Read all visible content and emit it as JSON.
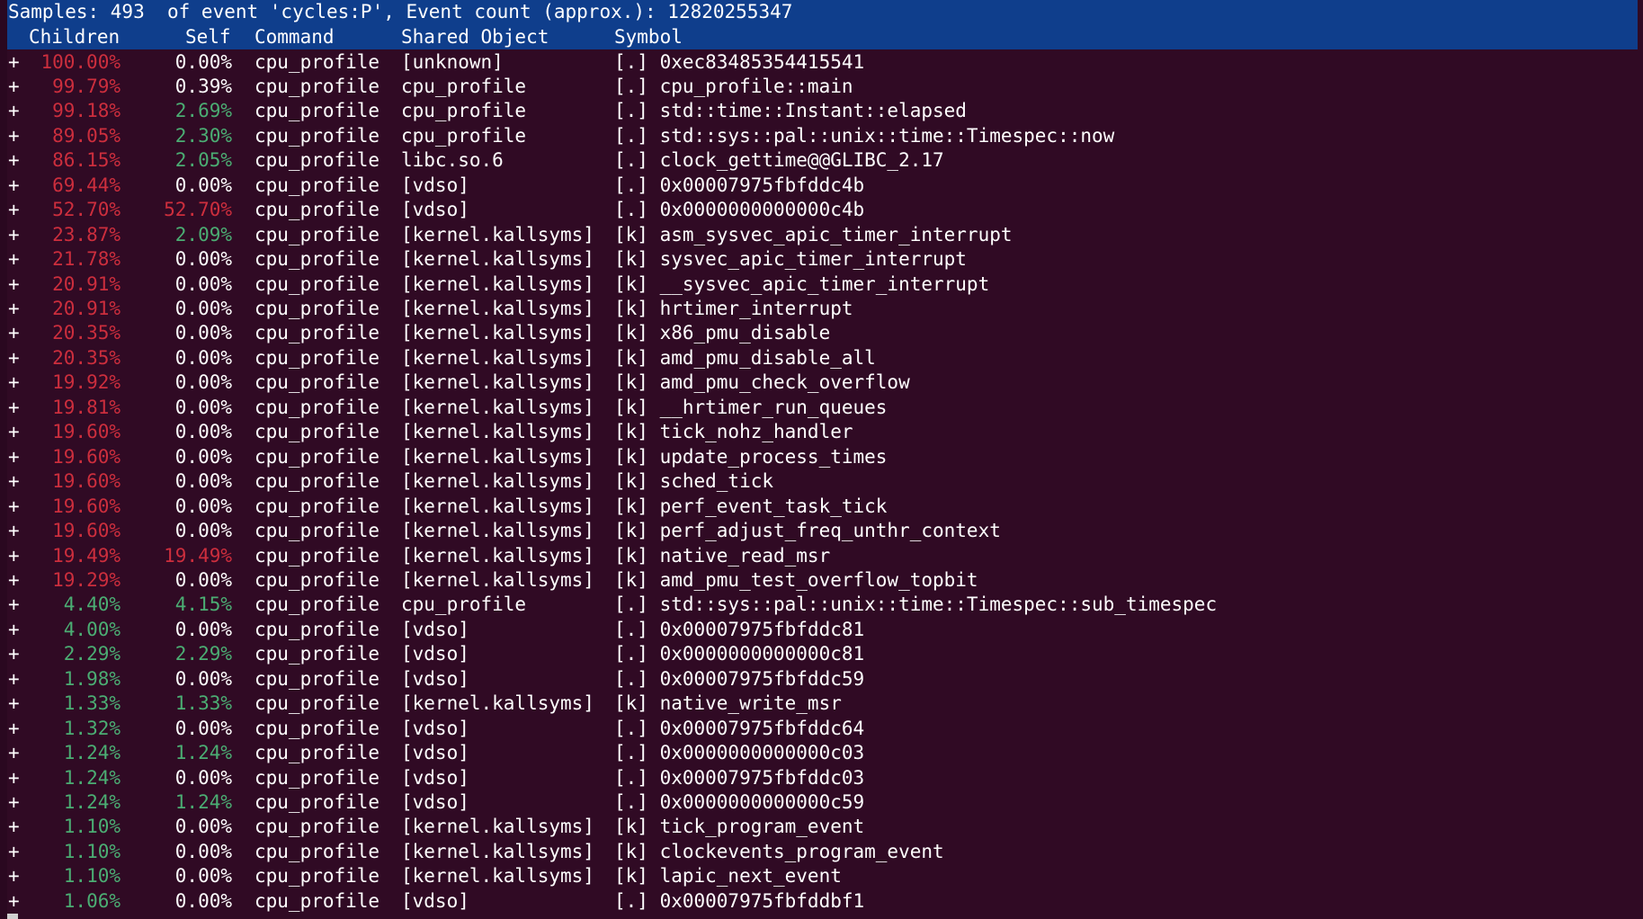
{
  "header": {
    "title": "Samples: 493  of event 'cycles:P', Event count (approx.): 12820255347",
    "columns": {
      "children": "Children",
      "self": "Self",
      "command": "Command",
      "shared_object": "Shared Object",
      "symbol": "Symbol"
    }
  },
  "colors": {
    "background": "#300a24",
    "header_bg": "#0f3e8c",
    "high_percent": "#cc2e3d",
    "low_percent": "#4bad73",
    "text": "#ffffff"
  },
  "rows": [
    {
      "expand": "+",
      "children": "100.00%",
      "children_color": "red",
      "self": "0.00%",
      "self_color": "white",
      "command": "cpu_profile",
      "object": "[unknown]",
      "symbol": "[.] 0xec83485354415541"
    },
    {
      "expand": "+",
      "children": "99.79%",
      "children_color": "red",
      "self": "0.39%",
      "self_color": "white",
      "command": "cpu_profile",
      "object": "cpu_profile",
      "symbol": "[.] cpu_profile::main"
    },
    {
      "expand": "+",
      "children": "99.18%",
      "children_color": "red",
      "self": "2.69%",
      "self_color": "green",
      "command": "cpu_profile",
      "object": "cpu_profile",
      "symbol": "[.] std::time::Instant::elapsed"
    },
    {
      "expand": "+",
      "children": "89.05%",
      "children_color": "red",
      "self": "2.30%",
      "self_color": "green",
      "command": "cpu_profile",
      "object": "cpu_profile",
      "symbol": "[.] std::sys::pal::unix::time::Timespec::now"
    },
    {
      "expand": "+",
      "children": "86.15%",
      "children_color": "red",
      "self": "2.05%",
      "self_color": "green",
      "command": "cpu_profile",
      "object": "libc.so.6",
      "symbol": "[.] clock_gettime@@GLIBC_2.17"
    },
    {
      "expand": "+",
      "children": "69.44%",
      "children_color": "red",
      "self": "0.00%",
      "self_color": "white",
      "command": "cpu_profile",
      "object": "[vdso]",
      "symbol": "[.] 0x00007975fbfddc4b"
    },
    {
      "expand": "+",
      "children": "52.70%",
      "children_color": "red",
      "self": "52.70%",
      "self_color": "red",
      "command": "cpu_profile",
      "object": "[vdso]",
      "symbol": "[.] 0x0000000000000c4b"
    },
    {
      "expand": "+",
      "children": "23.87%",
      "children_color": "red",
      "self": "2.09%",
      "self_color": "green",
      "command": "cpu_profile",
      "object": "[kernel.kallsyms]",
      "symbol": "[k] asm_sysvec_apic_timer_interrupt"
    },
    {
      "expand": "+",
      "children": "21.78%",
      "children_color": "red",
      "self": "0.00%",
      "self_color": "white",
      "command": "cpu_profile",
      "object": "[kernel.kallsyms]",
      "symbol": "[k] sysvec_apic_timer_interrupt"
    },
    {
      "expand": "+",
      "children": "20.91%",
      "children_color": "red",
      "self": "0.00%",
      "self_color": "white",
      "command": "cpu_profile",
      "object": "[kernel.kallsyms]",
      "symbol": "[k] __sysvec_apic_timer_interrupt"
    },
    {
      "expand": "+",
      "children": "20.91%",
      "children_color": "red",
      "self": "0.00%",
      "self_color": "white",
      "command": "cpu_profile",
      "object": "[kernel.kallsyms]",
      "symbol": "[k] hrtimer_interrupt"
    },
    {
      "expand": "+",
      "children": "20.35%",
      "children_color": "red",
      "self": "0.00%",
      "self_color": "white",
      "command": "cpu_profile",
      "object": "[kernel.kallsyms]",
      "symbol": "[k] x86_pmu_disable"
    },
    {
      "expand": "+",
      "children": "20.35%",
      "children_color": "red",
      "self": "0.00%",
      "self_color": "white",
      "command": "cpu_profile",
      "object": "[kernel.kallsyms]",
      "symbol": "[k] amd_pmu_disable_all"
    },
    {
      "expand": "+",
      "children": "19.92%",
      "children_color": "red",
      "self": "0.00%",
      "self_color": "white",
      "command": "cpu_profile",
      "object": "[kernel.kallsyms]",
      "symbol": "[k] amd_pmu_check_overflow"
    },
    {
      "expand": "+",
      "children": "19.81%",
      "children_color": "red",
      "self": "0.00%",
      "self_color": "white",
      "command": "cpu_profile",
      "object": "[kernel.kallsyms]",
      "symbol": "[k] __hrtimer_run_queues"
    },
    {
      "expand": "+",
      "children": "19.60%",
      "children_color": "red",
      "self": "0.00%",
      "self_color": "white",
      "command": "cpu_profile",
      "object": "[kernel.kallsyms]",
      "symbol": "[k] tick_nohz_handler"
    },
    {
      "expand": "+",
      "children": "19.60%",
      "children_color": "red",
      "self": "0.00%",
      "self_color": "white",
      "command": "cpu_profile",
      "object": "[kernel.kallsyms]",
      "symbol": "[k] update_process_times"
    },
    {
      "expand": "+",
      "children": "19.60%",
      "children_color": "red",
      "self": "0.00%",
      "self_color": "white",
      "command": "cpu_profile",
      "object": "[kernel.kallsyms]",
      "symbol": "[k] sched_tick"
    },
    {
      "expand": "+",
      "children": "19.60%",
      "children_color": "red",
      "self": "0.00%",
      "self_color": "white",
      "command": "cpu_profile",
      "object": "[kernel.kallsyms]",
      "symbol": "[k] perf_event_task_tick"
    },
    {
      "expand": "+",
      "children": "19.60%",
      "children_color": "red",
      "self": "0.00%",
      "self_color": "white",
      "command": "cpu_profile",
      "object": "[kernel.kallsyms]",
      "symbol": "[k] perf_adjust_freq_unthr_context"
    },
    {
      "expand": "+",
      "children": "19.49%",
      "children_color": "red",
      "self": "19.49%",
      "self_color": "red",
      "command": "cpu_profile",
      "object": "[kernel.kallsyms]",
      "symbol": "[k] native_read_msr"
    },
    {
      "expand": "+",
      "children": "19.29%",
      "children_color": "red",
      "self": "0.00%",
      "self_color": "white",
      "command": "cpu_profile",
      "object": "[kernel.kallsyms]",
      "symbol": "[k] amd_pmu_test_overflow_topbit"
    },
    {
      "expand": "+",
      "children": "4.40%",
      "children_color": "green",
      "self": "4.15%",
      "self_color": "green",
      "command": "cpu_profile",
      "object": "cpu_profile",
      "symbol": "[.] std::sys::pal::unix::time::Timespec::sub_timespec"
    },
    {
      "expand": "+",
      "children": "4.00%",
      "children_color": "green",
      "self": "0.00%",
      "self_color": "white",
      "command": "cpu_profile",
      "object": "[vdso]",
      "symbol": "[.] 0x00007975fbfddc81"
    },
    {
      "expand": "+",
      "children": "2.29%",
      "children_color": "green",
      "self": "2.29%",
      "self_color": "green",
      "command": "cpu_profile",
      "object": "[vdso]",
      "symbol": "[.] 0x0000000000000c81"
    },
    {
      "expand": "+",
      "children": "1.98%",
      "children_color": "green",
      "self": "0.00%",
      "self_color": "white",
      "command": "cpu_profile",
      "object": "[vdso]",
      "symbol": "[.] 0x00007975fbfddc59"
    },
    {
      "expand": "+",
      "children": "1.33%",
      "children_color": "green",
      "self": "1.33%",
      "self_color": "green",
      "command": "cpu_profile",
      "object": "[kernel.kallsyms]",
      "symbol": "[k] native_write_msr"
    },
    {
      "expand": "+",
      "children": "1.32%",
      "children_color": "green",
      "self": "0.00%",
      "self_color": "white",
      "command": "cpu_profile",
      "object": "[vdso]",
      "symbol": "[.] 0x00007975fbfddc64"
    },
    {
      "expand": "+",
      "children": "1.24%",
      "children_color": "green",
      "self": "1.24%",
      "self_color": "green",
      "command": "cpu_profile",
      "object": "[vdso]",
      "symbol": "[.] 0x0000000000000c03"
    },
    {
      "expand": "+",
      "children": "1.24%",
      "children_color": "green",
      "self": "0.00%",
      "self_color": "white",
      "command": "cpu_profile",
      "object": "[vdso]",
      "symbol": "[.] 0x00007975fbfddc03"
    },
    {
      "expand": "+",
      "children": "1.24%",
      "children_color": "green",
      "self": "1.24%",
      "self_color": "green",
      "command": "cpu_profile",
      "object": "[vdso]",
      "symbol": "[.] 0x0000000000000c59"
    },
    {
      "expand": "+",
      "children": "1.10%",
      "children_color": "green",
      "self": "0.00%",
      "self_color": "white",
      "command": "cpu_profile",
      "object": "[kernel.kallsyms]",
      "symbol": "[k] tick_program_event"
    },
    {
      "expand": "+",
      "children": "1.10%",
      "children_color": "green",
      "self": "0.00%",
      "self_color": "white",
      "command": "cpu_profile",
      "object": "[kernel.kallsyms]",
      "symbol": "[k] clockevents_program_event"
    },
    {
      "expand": "+",
      "children": "1.10%",
      "children_color": "green",
      "self": "0.00%",
      "self_color": "white",
      "command": "cpu_profile",
      "object": "[kernel.kallsyms]",
      "symbol": "[k] lapic_next_event"
    },
    {
      "expand": "+",
      "children": "1.06%",
      "children_color": "green",
      "self": "0.00%",
      "self_color": "white",
      "command": "cpu_profile",
      "object": "[vdso]",
      "symbol": "[.] 0x00007975fbfddbf1"
    }
  ]
}
